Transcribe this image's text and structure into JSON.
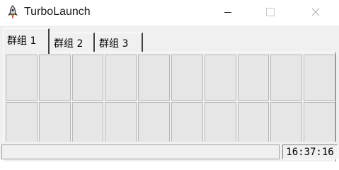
{
  "window": {
    "title": "TurboLaunch",
    "app_icon": "rocket-icon",
    "controls": [
      "minimize-icon",
      "maximize-icon",
      "close-icon"
    ]
  },
  "tabs": [
    {
      "label": "群组 1",
      "active": true
    },
    {
      "label": "群组 2",
      "active": false
    },
    {
      "label": "群组 3",
      "active": false
    }
  ],
  "grid": {
    "rows": 2,
    "columns": 10
  },
  "statusbar": {
    "message": "",
    "time": "16:37:16"
  }
}
